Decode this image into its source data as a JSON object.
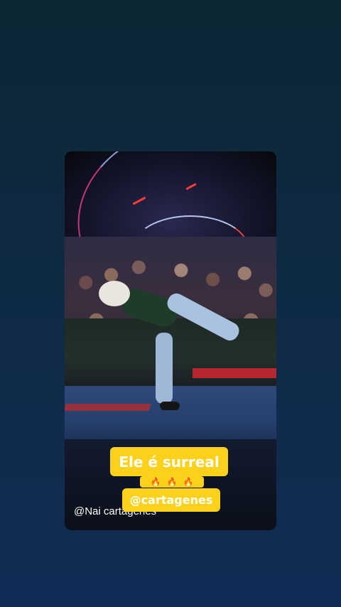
{
  "story": {
    "caption_main": "Ele é surreal",
    "emojis": [
      {
        "icon": "fire-icon",
        "glyph": "🔥"
      },
      {
        "icon": "fire-icon",
        "glyph": "🔥"
      },
      {
        "icon": "fire-icon",
        "glyph": "🔥"
      }
    ],
    "caption_handle": "@cartagenes",
    "watermark": "@Nai cartagenes"
  },
  "colors": {
    "caption_background": "#fbd11b",
    "caption_text": "#ffffff",
    "background_top": "#0d2633",
    "background_bottom": "#112c55"
  }
}
